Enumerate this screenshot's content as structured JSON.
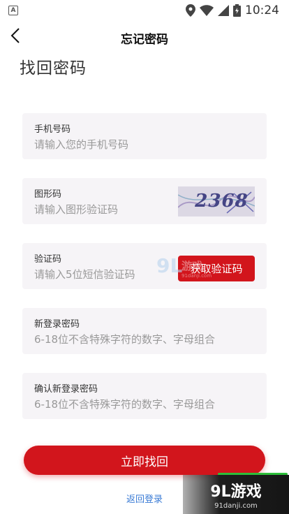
{
  "status_bar": {
    "time": "10:24",
    "left_icon": "A"
  },
  "nav": {
    "title": "忘记密码"
  },
  "page_title": "找回密码",
  "fields": {
    "phone": {
      "label": "手机号码",
      "placeholder": "请输入您的手机号码"
    },
    "captcha": {
      "label": "图形码",
      "placeholder": "请输入图形验证码",
      "image_text": "2368"
    },
    "sms": {
      "label": "验证码",
      "placeholder": "请输入5位短信验证码",
      "button": "获取验证码"
    },
    "new_password": {
      "label": "新登录密码",
      "placeholder": "6-18位不含特殊字符的数字、字母组合"
    },
    "confirm_password": {
      "label": "确认新登录密码",
      "placeholder": "6-18位不含特殊字符的数字、字母组合"
    }
  },
  "submit_label": "立即找回",
  "back_login_label": "返回登录",
  "watermark": {
    "brand": "9L游戏",
    "site": "91danji.com"
  },
  "colors": {
    "accent": "#d2151c",
    "field_bg": "#f6f4f7",
    "link": "#3a7bd5"
  }
}
